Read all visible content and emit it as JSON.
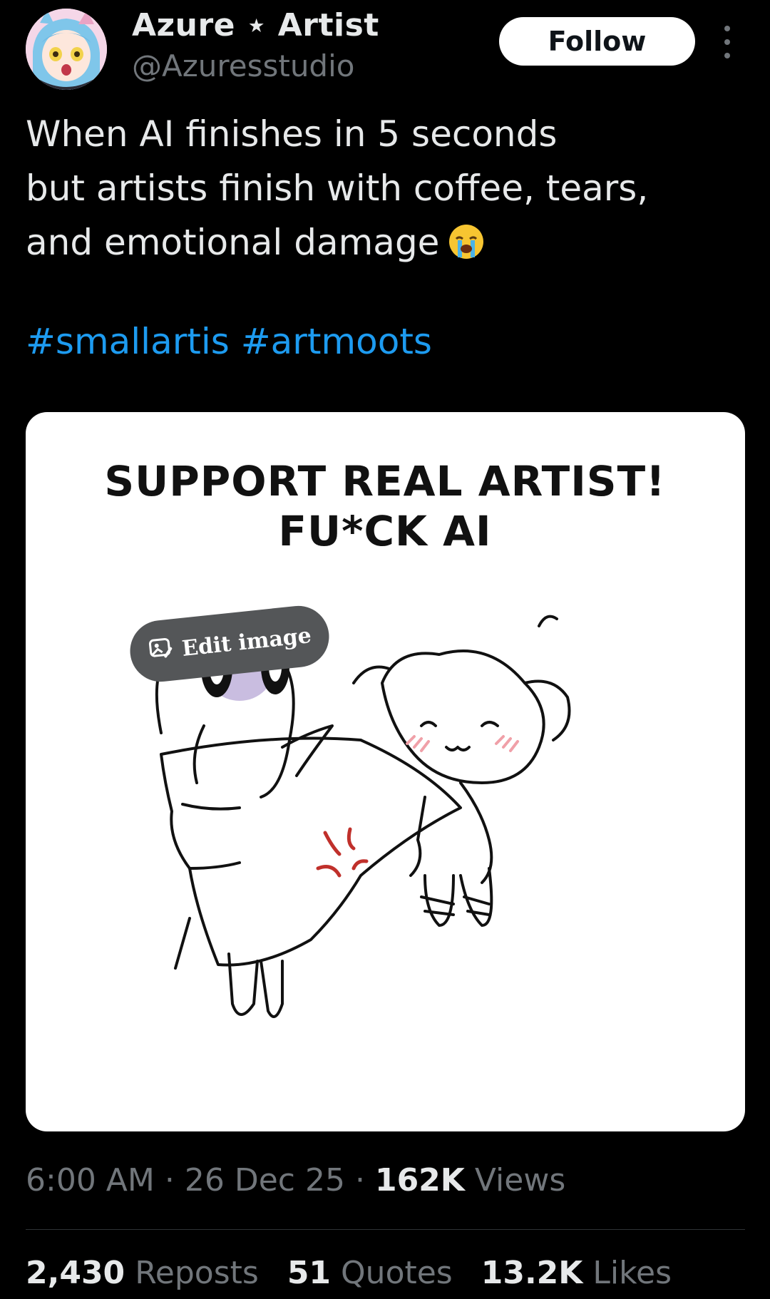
{
  "author": {
    "display_name": "Azure ⋆ Artist",
    "handle": "@Azuresstudio"
  },
  "header": {
    "follow_label": "Follow",
    "more_icon": "more-vertical-icon"
  },
  "tweet": {
    "lines": [
      "When AI finishes in 5 seconds",
      "but artists finish with coffee, tears,",
      "and emotional damage"
    ],
    "emoji_icon": "loudly-crying-face-icon",
    "hashtags": [
      "#smallartis",
      "#artmoots"
    ]
  },
  "media": {
    "title_lines": [
      "SUPPORT REAL ARTIST!",
      "FU*CK AI"
    ],
    "edit_label": "Edit image",
    "edit_icon": "edit-image-icon"
  },
  "meta": {
    "time": "6:00 AM",
    "date": "26 Dec 25",
    "views_count": "162K",
    "views_label": "Views",
    "separator": "·"
  },
  "stats": {
    "reposts_count": "2,430",
    "reposts_label": "Reposts",
    "quotes_count": "51",
    "quotes_label": "Quotes",
    "likes_count": "13.2K",
    "likes_label": "Likes"
  },
  "colors": {
    "background": "#000000",
    "text": "#e7e9ea",
    "muted": "#71767b",
    "link": "#1d9bf0",
    "anger": "#c0302b",
    "blush": "#f0a0a8",
    "purple": "#b7a7d6"
  }
}
